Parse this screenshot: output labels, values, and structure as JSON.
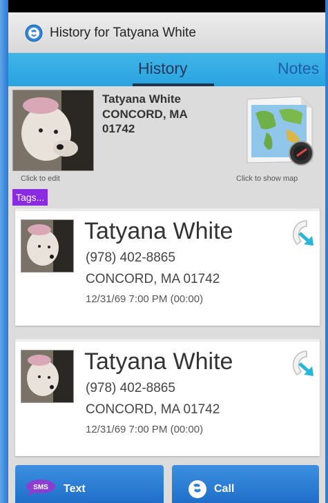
{
  "app": {
    "title": "History for Tatyana White",
    "icon": "help-phone-icon"
  },
  "tabs": [
    {
      "label": "History",
      "active": true
    },
    {
      "label": "Notes",
      "active": false
    }
  ],
  "contact": {
    "name": "Tatyana White",
    "address": "CONCORD, MA 01742",
    "photo_caption": "Click to edit",
    "map_caption": "Click to show map",
    "tags_label": "Tags..."
  },
  "history": [
    {
      "name": "Tatyana White",
      "phone": "(978) 402-8865",
      "address": "CONCORD, MA 01742",
      "datetime": "12/31/69 7:00 PM (00:00)",
      "call_icon": "outgoing-call-icon"
    },
    {
      "name": "Tatyana White",
      "phone": "(978) 402-8865",
      "address": "CONCORD, MA 01742",
      "datetime": "12/31/69 7:00 PM (00:00)",
      "call_icon": "outgoing-call-icon"
    }
  ],
  "actions": {
    "text_label": "Text",
    "call_label": "Call",
    "sms_badge": "SMS"
  },
  "colors": {
    "tab_bar": "#2aa3df",
    "tags_badge": "#8a2be2",
    "button": "#2a7fd6"
  }
}
